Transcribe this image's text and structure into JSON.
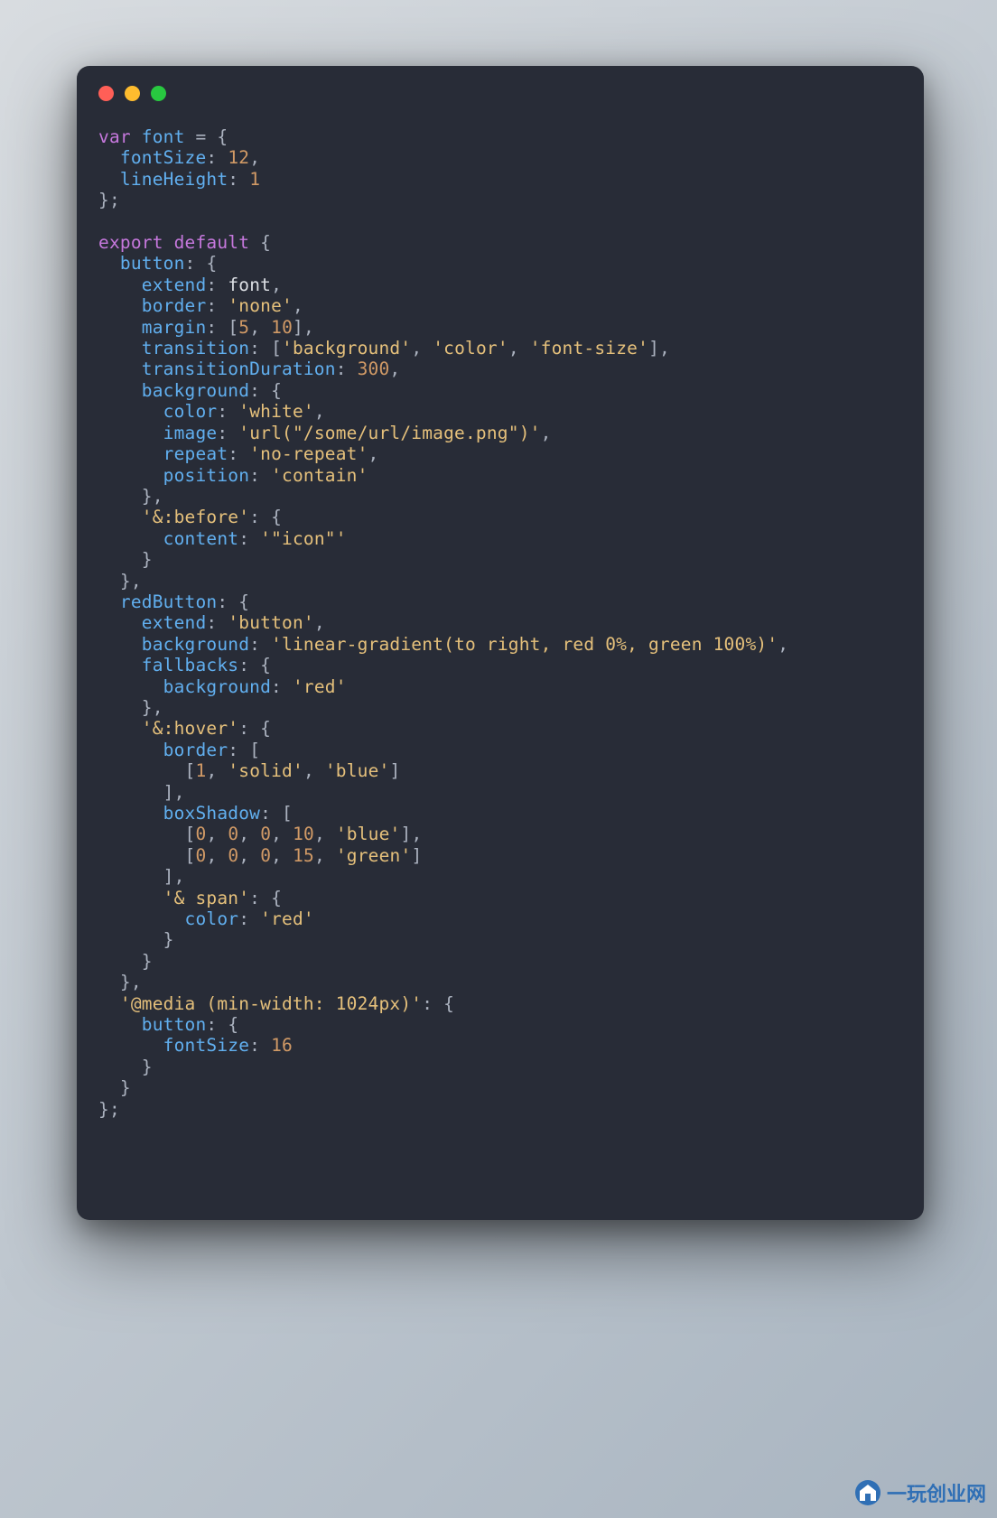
{
  "watermark": "一玩创业网",
  "code_tokens": [
    [
      [
        "kw",
        "var"
      ],
      [
        "w",
        " "
      ],
      [
        "id",
        "font"
      ],
      [
        "w",
        " "
      ],
      [
        "p",
        "="
      ],
      [
        "w",
        " "
      ],
      [
        "p",
        "{"
      ]
    ],
    [
      [
        "w",
        "  "
      ],
      [
        "id",
        "fontSize"
      ],
      [
        "p",
        ":"
      ],
      [
        "w",
        " "
      ],
      [
        "num",
        "12"
      ],
      [
        "p",
        ","
      ]
    ],
    [
      [
        "w",
        "  "
      ],
      [
        "id",
        "lineHeight"
      ],
      [
        "p",
        ":"
      ],
      [
        "w",
        " "
      ],
      [
        "num",
        "1"
      ]
    ],
    [
      [
        "p",
        "};"
      ]
    ],
    [],
    [
      [
        "kw",
        "export"
      ],
      [
        "w",
        " "
      ],
      [
        "kw",
        "default"
      ],
      [
        "w",
        " "
      ],
      [
        "p",
        "{"
      ]
    ],
    [
      [
        "w",
        "  "
      ],
      [
        "id",
        "button"
      ],
      [
        "p",
        ":"
      ],
      [
        "w",
        " "
      ],
      [
        "p",
        "{"
      ]
    ],
    [
      [
        "w",
        "    "
      ],
      [
        "id",
        "extend"
      ],
      [
        "p",
        ":"
      ],
      [
        "w",
        " "
      ],
      [
        "w",
        "font"
      ],
      [
        "p",
        ","
      ]
    ],
    [
      [
        "w",
        "    "
      ],
      [
        "id",
        "border"
      ],
      [
        "p",
        ":"
      ],
      [
        "w",
        " "
      ],
      [
        "str",
        "'none'"
      ],
      [
        "p",
        ","
      ]
    ],
    [
      [
        "w",
        "    "
      ],
      [
        "id",
        "margin"
      ],
      [
        "p",
        ":"
      ],
      [
        "w",
        " "
      ],
      [
        "p",
        "["
      ],
      [
        "num",
        "5"
      ],
      [
        "p",
        ","
      ],
      [
        "w",
        " "
      ],
      [
        "num",
        "10"
      ],
      [
        "p",
        "]"
      ],
      [
        "p",
        ","
      ]
    ],
    [
      [
        "w",
        "    "
      ],
      [
        "id",
        "transition"
      ],
      [
        "p",
        ":"
      ],
      [
        "w",
        " "
      ],
      [
        "p",
        "["
      ],
      [
        "str",
        "'background'"
      ],
      [
        "p",
        ","
      ],
      [
        "w",
        " "
      ],
      [
        "str",
        "'color'"
      ],
      [
        "p",
        ","
      ],
      [
        "w",
        " "
      ],
      [
        "str",
        "'font-size'"
      ],
      [
        "p",
        "]"
      ],
      [
        "p",
        ","
      ]
    ],
    [
      [
        "w",
        "    "
      ],
      [
        "id",
        "transitionDuration"
      ],
      [
        "p",
        ":"
      ],
      [
        "w",
        " "
      ],
      [
        "num",
        "300"
      ],
      [
        "p",
        ","
      ]
    ],
    [
      [
        "w",
        "    "
      ],
      [
        "id",
        "background"
      ],
      [
        "p",
        ":"
      ],
      [
        "w",
        " "
      ],
      [
        "p",
        "{"
      ]
    ],
    [
      [
        "w",
        "      "
      ],
      [
        "id",
        "color"
      ],
      [
        "p",
        ":"
      ],
      [
        "w",
        " "
      ],
      [
        "str",
        "'white'"
      ],
      [
        "p",
        ","
      ]
    ],
    [
      [
        "w",
        "      "
      ],
      [
        "id",
        "image"
      ],
      [
        "p",
        ":"
      ],
      [
        "w",
        " "
      ],
      [
        "str",
        "'url(\"/some/url/image.png\")'"
      ],
      [
        "p",
        ","
      ]
    ],
    [
      [
        "w",
        "      "
      ],
      [
        "id",
        "repeat"
      ],
      [
        "p",
        ":"
      ],
      [
        "w",
        " "
      ],
      [
        "str",
        "'no-repeat'"
      ],
      [
        "p",
        ","
      ]
    ],
    [
      [
        "w",
        "      "
      ],
      [
        "id",
        "position"
      ],
      [
        "p",
        ":"
      ],
      [
        "w",
        " "
      ],
      [
        "str",
        "'contain'"
      ]
    ],
    [
      [
        "w",
        "    "
      ],
      [
        "p",
        "},"
      ]
    ],
    [
      [
        "w",
        "    "
      ],
      [
        "str",
        "'&:before'"
      ],
      [
        "p",
        ":"
      ],
      [
        "w",
        " "
      ],
      [
        "p",
        "{"
      ]
    ],
    [
      [
        "w",
        "      "
      ],
      [
        "id",
        "content"
      ],
      [
        "p",
        ":"
      ],
      [
        "w",
        " "
      ],
      [
        "str",
        "'\"icon\"'"
      ]
    ],
    [
      [
        "w",
        "    "
      ],
      [
        "p",
        "}"
      ]
    ],
    [
      [
        "w",
        "  "
      ],
      [
        "p",
        "},"
      ]
    ],
    [
      [
        "w",
        "  "
      ],
      [
        "id",
        "redButton"
      ],
      [
        "p",
        ":"
      ],
      [
        "w",
        " "
      ],
      [
        "p",
        "{"
      ]
    ],
    [
      [
        "w",
        "    "
      ],
      [
        "id",
        "extend"
      ],
      [
        "p",
        ":"
      ],
      [
        "w",
        " "
      ],
      [
        "str",
        "'button'"
      ],
      [
        "p",
        ","
      ]
    ],
    [
      [
        "w",
        "    "
      ],
      [
        "id",
        "background"
      ],
      [
        "p",
        ":"
      ],
      [
        "w",
        " "
      ],
      [
        "str",
        "'linear-gradient(to right, red 0%, green 100%)'"
      ],
      [
        "p",
        ","
      ]
    ],
    [
      [
        "w",
        "    "
      ],
      [
        "id",
        "fallbacks"
      ],
      [
        "p",
        ":"
      ],
      [
        "w",
        " "
      ],
      [
        "p",
        "{"
      ]
    ],
    [
      [
        "w",
        "      "
      ],
      [
        "id",
        "background"
      ],
      [
        "p",
        ":"
      ],
      [
        "w",
        " "
      ],
      [
        "str",
        "'red'"
      ]
    ],
    [
      [
        "w",
        "    "
      ],
      [
        "p",
        "},"
      ]
    ],
    [
      [
        "w",
        "    "
      ],
      [
        "str",
        "'&:hover'"
      ],
      [
        "p",
        ":"
      ],
      [
        "w",
        " "
      ],
      [
        "p",
        "{"
      ]
    ],
    [
      [
        "w",
        "      "
      ],
      [
        "id",
        "border"
      ],
      [
        "p",
        ":"
      ],
      [
        "w",
        " "
      ],
      [
        "p",
        "["
      ]
    ],
    [
      [
        "w",
        "        "
      ],
      [
        "p",
        "["
      ],
      [
        "num",
        "1"
      ],
      [
        "p",
        ","
      ],
      [
        "w",
        " "
      ],
      [
        "str",
        "'solid'"
      ],
      [
        "p",
        ","
      ],
      [
        "w",
        " "
      ],
      [
        "str",
        "'blue'"
      ],
      [
        "p",
        "]"
      ]
    ],
    [
      [
        "w",
        "      "
      ],
      [
        "p",
        "],"
      ]
    ],
    [
      [
        "w",
        "      "
      ],
      [
        "id",
        "boxShadow"
      ],
      [
        "p",
        ":"
      ],
      [
        "w",
        " "
      ],
      [
        "p",
        "["
      ]
    ],
    [
      [
        "w",
        "        "
      ],
      [
        "p",
        "["
      ],
      [
        "num",
        "0"
      ],
      [
        "p",
        ","
      ],
      [
        "w",
        " "
      ],
      [
        "num",
        "0"
      ],
      [
        "p",
        ","
      ],
      [
        "w",
        " "
      ],
      [
        "num",
        "0"
      ],
      [
        "p",
        ","
      ],
      [
        "w",
        " "
      ],
      [
        "num",
        "10"
      ],
      [
        "p",
        ","
      ],
      [
        "w",
        " "
      ],
      [
        "str",
        "'blue'"
      ],
      [
        "p",
        "],"
      ]
    ],
    [
      [
        "w",
        "        "
      ],
      [
        "p",
        "["
      ],
      [
        "num",
        "0"
      ],
      [
        "p",
        ","
      ],
      [
        "w",
        " "
      ],
      [
        "num",
        "0"
      ],
      [
        "p",
        ","
      ],
      [
        "w",
        " "
      ],
      [
        "num",
        "0"
      ],
      [
        "p",
        ","
      ],
      [
        "w",
        " "
      ],
      [
        "num",
        "15"
      ],
      [
        "p",
        ","
      ],
      [
        "w",
        " "
      ],
      [
        "str",
        "'green'"
      ],
      [
        "p",
        "]"
      ]
    ],
    [
      [
        "w",
        "      "
      ],
      [
        "p",
        "],"
      ]
    ],
    [
      [
        "w",
        "      "
      ],
      [
        "str",
        "'& span'"
      ],
      [
        "p",
        ":"
      ],
      [
        "w",
        " "
      ],
      [
        "p",
        "{"
      ]
    ],
    [
      [
        "w",
        "        "
      ],
      [
        "id",
        "color"
      ],
      [
        "p",
        ":"
      ],
      [
        "w",
        " "
      ],
      [
        "str",
        "'red'"
      ]
    ],
    [
      [
        "w",
        "      "
      ],
      [
        "p",
        "}"
      ]
    ],
    [
      [
        "w",
        "    "
      ],
      [
        "p",
        "}"
      ]
    ],
    [
      [
        "w",
        "  "
      ],
      [
        "p",
        "},"
      ]
    ],
    [
      [
        "w",
        "  "
      ],
      [
        "str",
        "'@media (min-width: 1024px)'"
      ],
      [
        "p",
        ":"
      ],
      [
        "w",
        " "
      ],
      [
        "p",
        "{"
      ]
    ],
    [
      [
        "w",
        "    "
      ],
      [
        "id",
        "button"
      ],
      [
        "p",
        ":"
      ],
      [
        "w",
        " "
      ],
      [
        "p",
        "{"
      ]
    ],
    [
      [
        "w",
        "      "
      ],
      [
        "id",
        "fontSize"
      ],
      [
        "p",
        ":"
      ],
      [
        "w",
        " "
      ],
      [
        "num",
        "16"
      ]
    ],
    [
      [
        "w",
        "    "
      ],
      [
        "p",
        "}"
      ]
    ],
    [
      [
        "w",
        "  "
      ],
      [
        "p",
        "}"
      ]
    ],
    [
      [
        "p",
        "};"
      ]
    ]
  ]
}
